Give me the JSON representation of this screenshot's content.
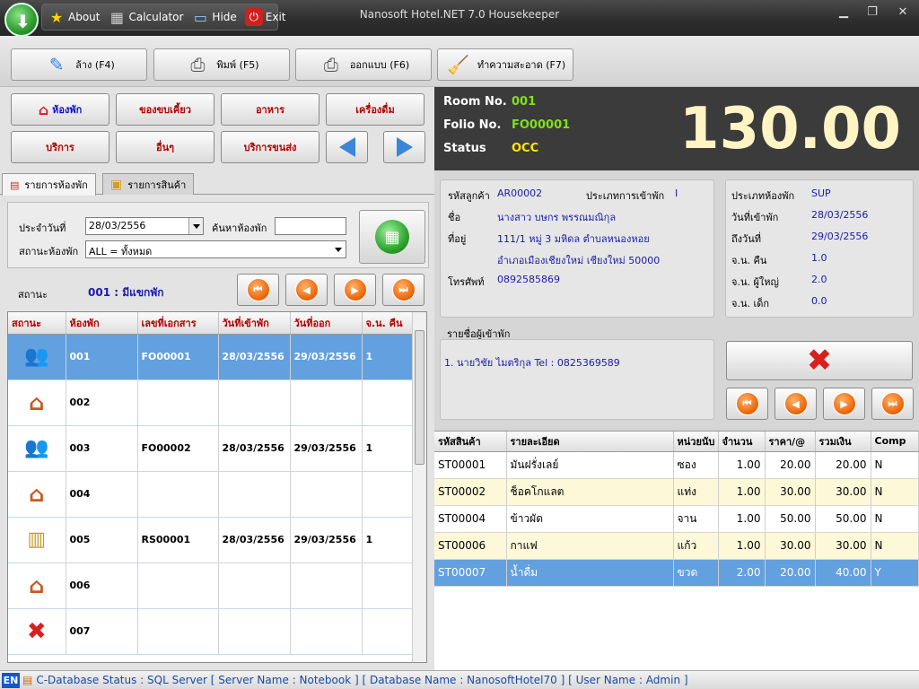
{
  "app": {
    "title": "Nanosoft Hotel.NET 7.0 Housekeeper"
  },
  "quickbar": {
    "about": "About",
    "calculator": "Calculator",
    "hide": "Hide",
    "exit": "Exit"
  },
  "toolbar": {
    "clear": "ล้าง (F4)",
    "print": "พิมพ์ (F5)",
    "design": "ออกแบบ (F6)",
    "clean": "ทำความสะอาด (F7)"
  },
  "categories": [
    {
      "label": "ห้องพัก"
    },
    {
      "label": "ของขบเคี้ยว"
    },
    {
      "label": "อาหาร"
    },
    {
      "label": "เครื่องดื่ม"
    },
    {
      "label": "บริการ"
    },
    {
      "label": "อื่นๆ"
    },
    {
      "label": "บริการขนส่ง"
    }
  ],
  "tabs": {
    "rooms": "รายการห้องพัก",
    "products": "รายการสินค้า"
  },
  "filter": {
    "date_label": "ประจำวันที่",
    "date_value": "28/03/2556",
    "search_label": "ค้นหาห้องพัก",
    "search_value": "",
    "status_label": "สถานะห้องพัก",
    "status_value": "ALL = ทั้งหมด"
  },
  "status_line": {
    "label": "สถานะ",
    "value": "001 : มีแขกพัก"
  },
  "room_grid": {
    "headers": [
      "สถานะ",
      "ห้องพัก",
      "เลขที่เอกสาร",
      "วันที่เข้าพัก",
      "วันที่ออก",
      "จ.น. คืน"
    ],
    "rows": [
      {
        "icon": "guest-icon",
        "room": "001",
        "doc": "FO00001",
        "checkin": "28/03/2556",
        "checkout": "29/03/2556",
        "nights": "1"
      },
      {
        "icon": "house-icon",
        "room": "002",
        "doc": "",
        "checkin": "",
        "checkout": "",
        "nights": ""
      },
      {
        "icon": "guest-icon",
        "room": "003",
        "doc": "FO00002",
        "checkin": "28/03/2556",
        "checkout": "29/03/2556",
        "nights": "1"
      },
      {
        "icon": "house-icon",
        "room": "004",
        "doc": "",
        "checkin": "",
        "checkout": "",
        "nights": ""
      },
      {
        "icon": "reservation-book-icon",
        "room": "005",
        "doc": "RS00001",
        "checkin": "28/03/2556",
        "checkout": "29/03/2556",
        "nights": "1"
      },
      {
        "icon": "house-icon",
        "room": "006",
        "doc": "",
        "checkin": "",
        "checkout": "",
        "nights": ""
      },
      {
        "icon": "red-x-icon",
        "room": "007",
        "doc": "",
        "checkin": "",
        "checkout": "",
        "nights": ""
      }
    ]
  },
  "info": {
    "room_no_label": "Room No.",
    "room_no": "001",
    "folio_label": "Folio No.",
    "folio": "FO00001",
    "status_label": "Status",
    "status": "OCC",
    "amount": "130.00"
  },
  "customer": {
    "code_label": "รหัสลูกค้า",
    "code": "AR00002",
    "type_label": "ประเภทการเข้าพัก",
    "type": "I",
    "name_label": "ชื่อ",
    "name": "นางสาว บษกร พรรณมณิกุล",
    "addr_label": "ที่อยู่",
    "addr1": "111/1 หมู่ 3 มหิดล ตำบลหนองหอย",
    "addr2": "อำเภอเมืองเชียงใหม่ เชียงใหม่ 50000",
    "phone_label": "โทรศัพท์",
    "phone": "0892585869"
  },
  "stay": {
    "room_type_label": "ประเภทห้องพัก",
    "room_type": "SUP",
    "checkin_label": "วันที่เข้าพัก",
    "checkin": "28/03/2556",
    "checkout_label": "ถึงวันที่",
    "checkout": "29/03/2556",
    "nights_label": "จ.น. คืน",
    "nights": "1.0",
    "adults_label": "จ.น. ผู้ใหญ่",
    "adults": "2.0",
    "children_label": "จ.น. เด็ก",
    "children": "0.0"
  },
  "guests": {
    "label": "รายชื่อผู้เข้าพัก",
    "entry": "1. นายวิชัย ไมตริกุล   Tel : 0825369589"
  },
  "items_grid": {
    "headers": [
      "รหัสสินค้า",
      "รายละเอียด",
      "หน่วยนับ",
      "จำนวน",
      "ราคา/@",
      "รวมเงิน",
      "Comp"
    ],
    "rows": [
      {
        "code": "ST00001",
        "desc": "มันฝรั่งเลย์",
        "unit": "ซอง",
        "qty": "1.00",
        "price": "20.00",
        "total": "20.00",
        "comp": "N"
      },
      {
        "code": "ST00002",
        "desc": "ช็อคโกแลต",
        "unit": "แท่ง",
        "qty": "1.00",
        "price": "30.00",
        "total": "30.00",
        "comp": "N"
      },
      {
        "code": "ST00004",
        "desc": "ข้าวผัด",
        "unit": "จาน",
        "qty": "1.00",
        "price": "50.00",
        "total": "50.00",
        "comp": "N"
      },
      {
        "code": "ST00006",
        "desc": "กาแฟ",
        "unit": "แก้ว",
        "qty": "1.00",
        "price": "30.00",
        "total": "30.00",
        "comp": "N"
      },
      {
        "code": "ST00007",
        "desc": "น้ำดื่ม",
        "unit": "ขวด",
        "qty": "2.00",
        "price": "20.00",
        "total": "40.00",
        "comp": "Y"
      }
    ]
  },
  "statusbar": {
    "lang": "EN",
    "text": "C-Database Status : SQL Server [ Server Name : Notebook ]  [ Database Name : NanosoftHotel70 ]  [ User Name : Admin ]"
  },
  "colors": {
    "accent_green": "#7ee01a",
    "status_yellow": "#ffe600",
    "amount": "#fff4c4",
    "selection": "#62a0e0",
    "header_red": "#b00000"
  }
}
